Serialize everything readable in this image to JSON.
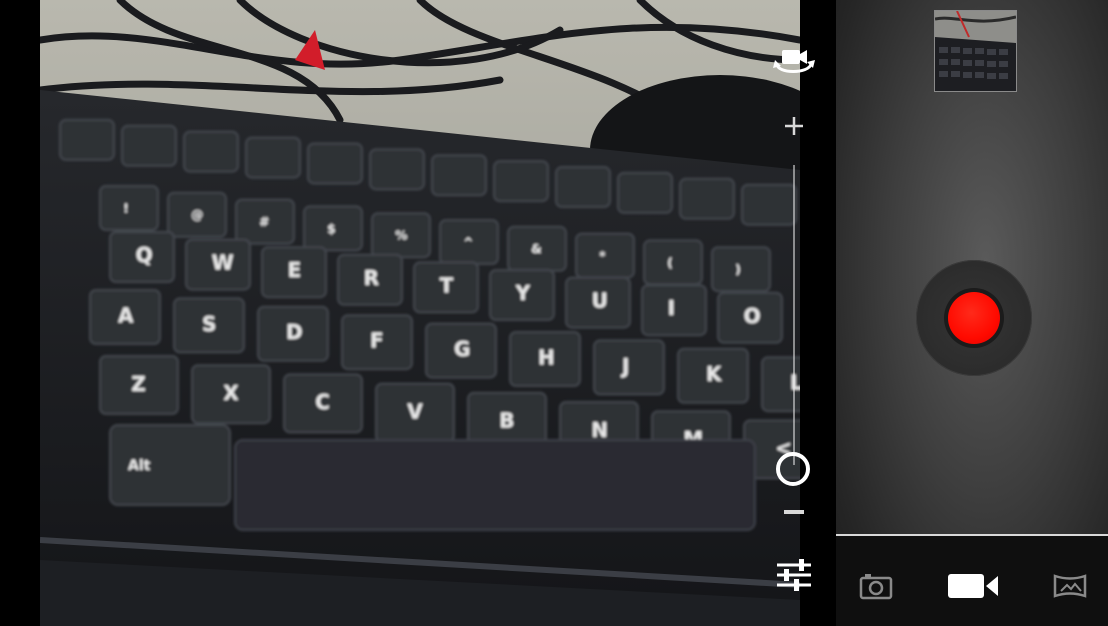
{
  "viewfinder": {
    "row1_keys": [
      "",
      "",
      "",
      "",
      "",
      "",
      "",
      "",
      "",
      "",
      "",
      ""
    ],
    "row2_keys": [
      "!",
      "@",
      "#",
      "$",
      "%",
      "^",
      "&",
      "*",
      "(",
      ")"
    ],
    "row3_keys": [
      "Q",
      "W",
      "E",
      "R",
      "T",
      "Y",
      "U",
      "I",
      "O"
    ],
    "row4_keys": [
      "A",
      "S",
      "D",
      "F",
      "G",
      "H",
      "J",
      "K",
      "L"
    ],
    "row5_keys": [
      "Z",
      "X",
      "C",
      "V",
      "B",
      "N",
      "M",
      "<"
    ],
    "alt_key": "Alt"
  },
  "zoom": {
    "level": 0.0
  },
  "icons": {
    "switch_camera": "switch-camera-icon",
    "zoom_in": "plus-icon",
    "zoom_out": "minus-icon",
    "settings": "sliders-icon",
    "photo_mode": "camera-icon",
    "video_mode": "video-camera-icon",
    "panorama_mode": "panorama-icon"
  },
  "colors": {
    "record_red": "#ff0a00",
    "active_mode": "#ffffff",
    "inactive_mode": "#8a8a8a"
  },
  "modes": [
    {
      "name": "photo",
      "active": false
    },
    {
      "name": "video",
      "active": true
    },
    {
      "name": "panorama",
      "active": false
    }
  ]
}
